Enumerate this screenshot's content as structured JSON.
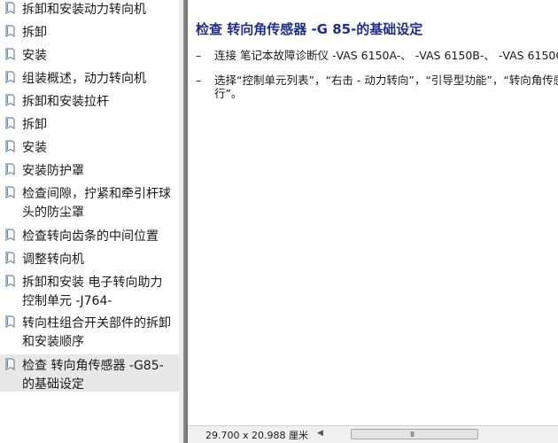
{
  "nav": {
    "items": [
      {
        "label": "拆卸和安装动力转向机",
        "selected": false
      },
      {
        "label": "拆卸",
        "selected": false
      },
      {
        "label": "安装",
        "selected": false
      },
      {
        "label": "组装概述，动力转向机",
        "selected": false
      },
      {
        "label": "拆卸和安装拉杆",
        "selected": false
      },
      {
        "label": "拆卸",
        "selected": false
      },
      {
        "label": "安装",
        "selected": false
      },
      {
        "label": "安装防护罩",
        "selected": false
      },
      {
        "label": "检查间隙，拧紧和牵引杆球头的防尘罩",
        "selected": false
      },
      {
        "label": "检查转向齿条的中间位置",
        "selected": false
      },
      {
        "label": "调整转向机",
        "selected": false
      },
      {
        "label": "拆卸和安装 电子转向助力控制单元 -J764-",
        "selected": false
      },
      {
        "label": "转向柱组合开关部件的拆卸和安装顺序",
        "selected": false
      },
      {
        "label": "检查 转向角传感器 -G85-的基础设定",
        "selected": true
      }
    ]
  },
  "content": {
    "title": "检查 转向角传感器 -G 85-的基础设定",
    "steps": [
      {
        "dash": "–",
        "line1": "连接 笔记本故障诊断仪 -VAS 6150A-、 -VAS 6150B-、 -VAS 6150C",
        "line2": ""
      },
      {
        "dash": "–",
        "line1": "选择“控制单元列表”，“右击 - 动力转向”，“引导型功能”，“转向角传感",
        "line2": "行”。"
      }
    ]
  },
  "status": {
    "page_size": "29.700 x 20.988 厘米",
    "scroll_left_glyph": "◀",
    "scroll_grip": "III"
  },
  "colors": {
    "title": "#1f2f8a",
    "selected_bg": "#e8e8e8",
    "icon": "#6d8aa8"
  }
}
